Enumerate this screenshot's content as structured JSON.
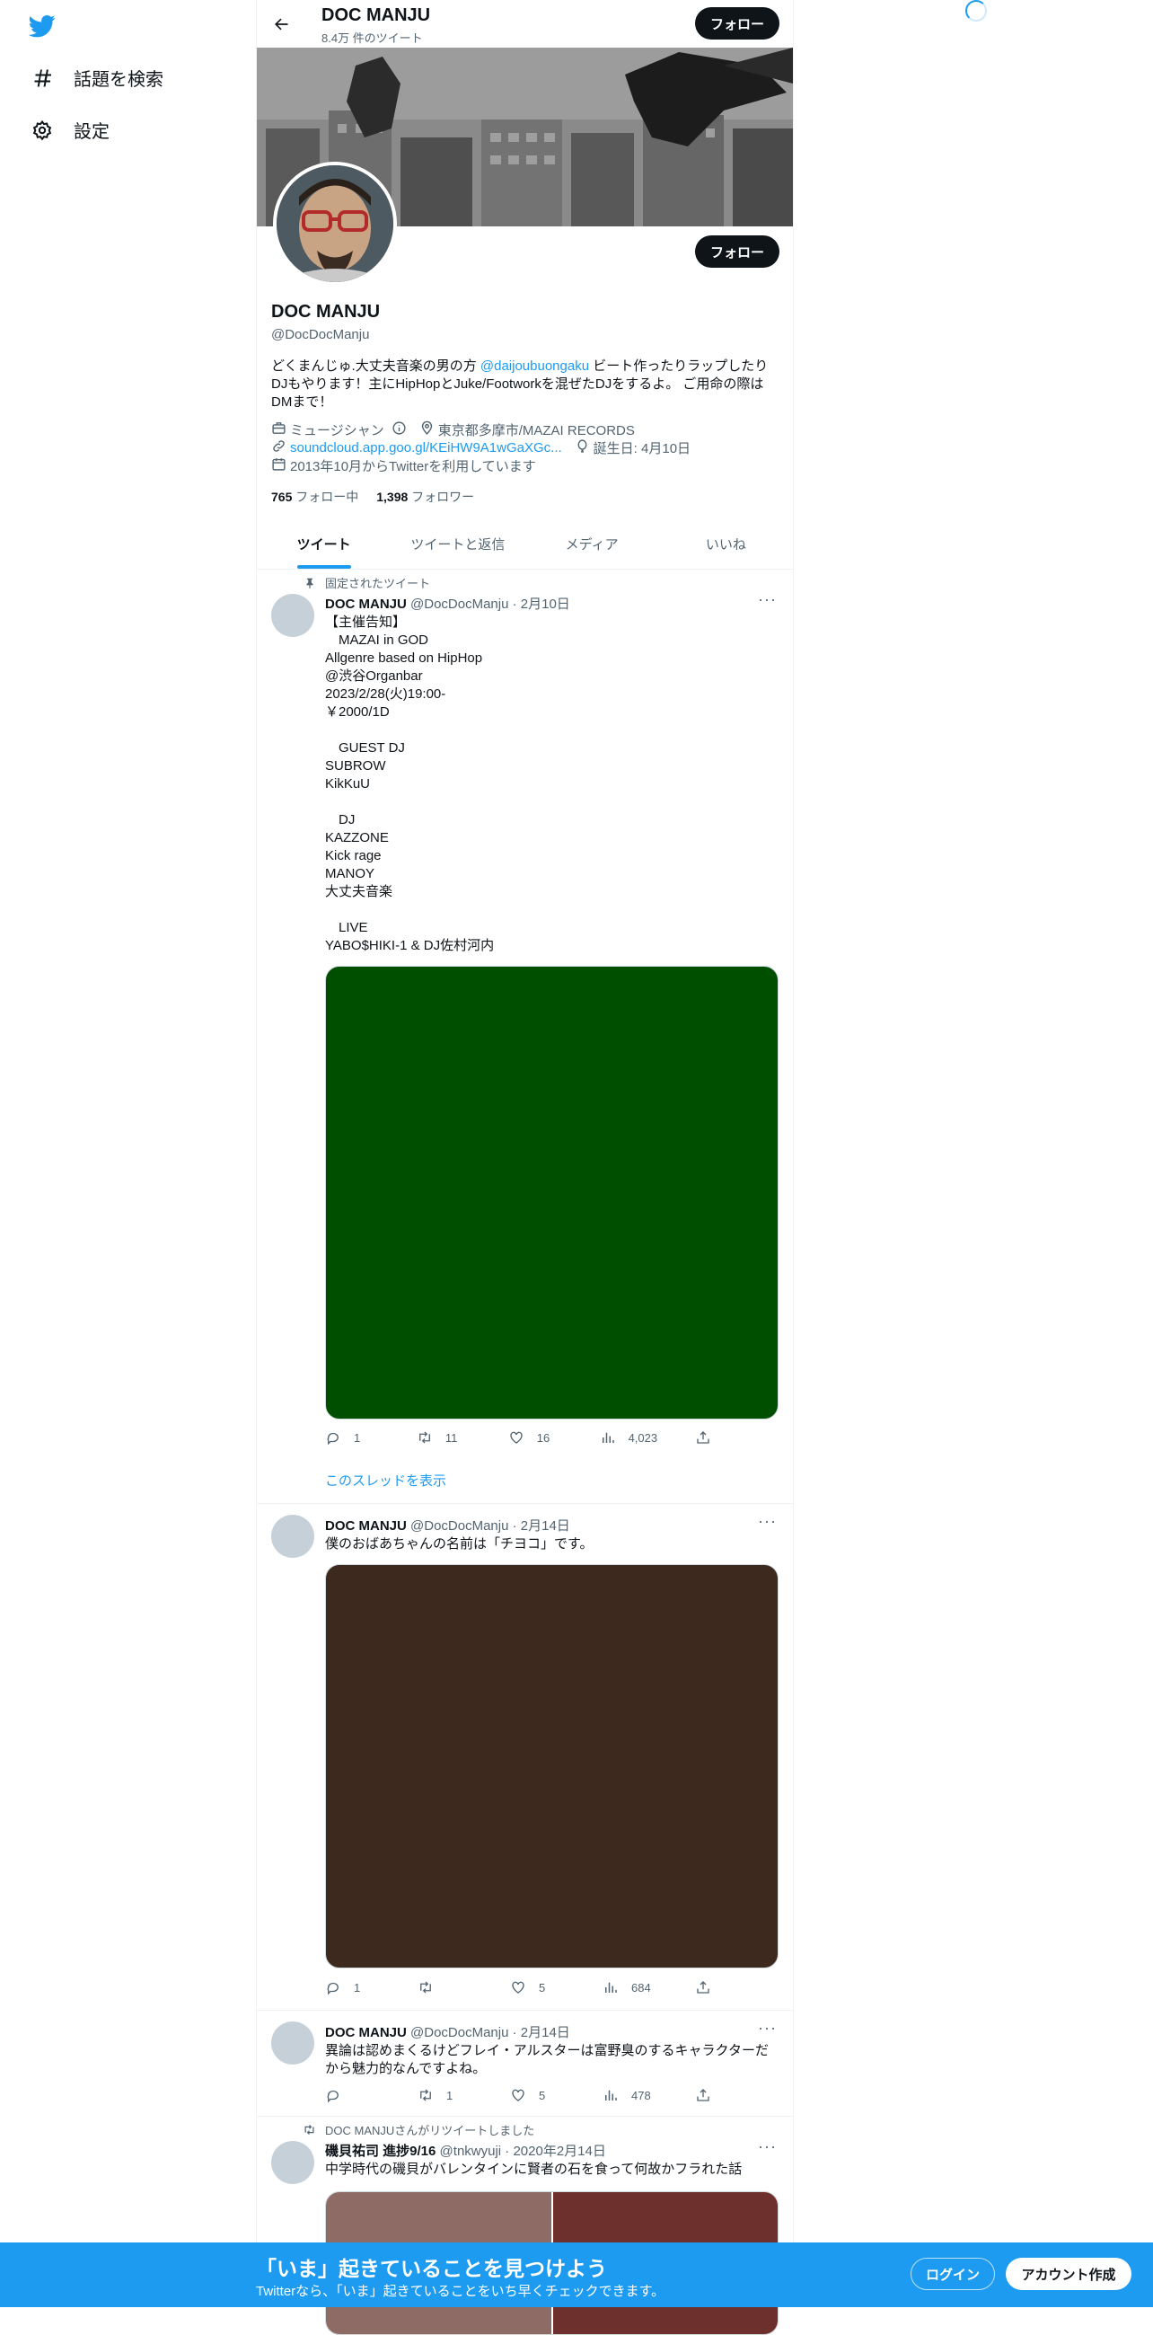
{
  "nav": {
    "explore_label": "話題を検索",
    "settings_label": "設定"
  },
  "header": {
    "name": "DOC MANJU",
    "tweet_count": "8.4万 件のツイート",
    "follow_label": "フォロー"
  },
  "profile": {
    "name": "DOC MANJU",
    "handle": "@DocDocManju",
    "follow_label": "フォロー",
    "bio_before": "どくまんじゅ.大丈夫音楽の男の方 ",
    "bio_mention": "@daijoubuongaku",
    "bio_after": " ビート作ったりラップしたりDJもやります！主にHipHopとJuke/Footworkを混ぜたDJをするよ。 ご用命の際はDMまで！",
    "profession": "ミュージシャン",
    "location": "東京都多摩市/MAZAI RECORDS",
    "url": "soundcloud.app.goo.gl/KEiHW9A1wGaXGc...",
    "birthday": "誕生日: 4月10日",
    "joined": "2013年10月からTwitterを利用しています",
    "following_count": "765",
    "following_label": "フォロー中",
    "followers_count": "1,398",
    "followers_label": "フォロワー"
  },
  "tabs": [
    "ツイート",
    "ツイートと返信",
    "メディア",
    "いいね"
  ],
  "tweets": [
    {
      "pinned_label": "固定されたツイート",
      "name": "DOC MANJU",
      "handle_date": "@DocDocManju · 2月10日",
      "text": "【主催告知】\n　MAZAI in GOD\nAllgenre based on HipHop\n@渋谷Organbar\n2023/2/28(火)19:00-\n￥2000/1D\n\n　GUEST DJ\nSUBROW\nKikKuU\n\n　DJ\nKAZZONE\nKick rage\nMANOY\n大丈夫音楽\n\n　LIVE\nYABO$HIKI-1 & DJ佐村河内",
      "media_color": "#004f00",
      "replies": "1",
      "retweets": "11",
      "likes": "16",
      "views": "4,023",
      "thread_label": "このスレッドを表示"
    },
    {
      "name": "DOC MANJU",
      "handle_date": "@DocDocManju · 2月14日",
      "text": "僕のおばあちゃんの名前は「チヨコ」です。",
      "media_color": "#3d291e",
      "replies": "1",
      "retweets": "",
      "likes": "5",
      "views": "684"
    },
    {
      "name": "DOC MANJU",
      "handle_date": "@DocDocManju · 2月14日",
      "text": "異論は認めまくるけどフレイ・アルスターは富野臭のするキャラクターだから魅力的なんですよね。",
      "replies": "",
      "retweets": "1",
      "likes": "5",
      "views": "478"
    },
    {
      "retweeted_label": "DOC MANJUさんがリツイートしました",
      "name": "磯貝祐司 進捗9/16",
      "handle_date": "@tnkwyuji · 2020年2月14日",
      "text": "中学時代の磯貝がバレンタインに賢者の石を食って何故かフラれた話",
      "media_colors": [
        "#8e6c65",
        "#6e302d"
      ]
    }
  ],
  "bottom_bar": {
    "title": "「いま」起きていることを見つけよう",
    "subtitle": "Twitterなら、「いま」起きていることをいち早くチェックできます。",
    "login_label": "ログイン",
    "signup_label": "アカウント作成"
  },
  "colors": {
    "accent": "#1d9bf0",
    "text": "#0f1419",
    "muted": "#536471"
  }
}
